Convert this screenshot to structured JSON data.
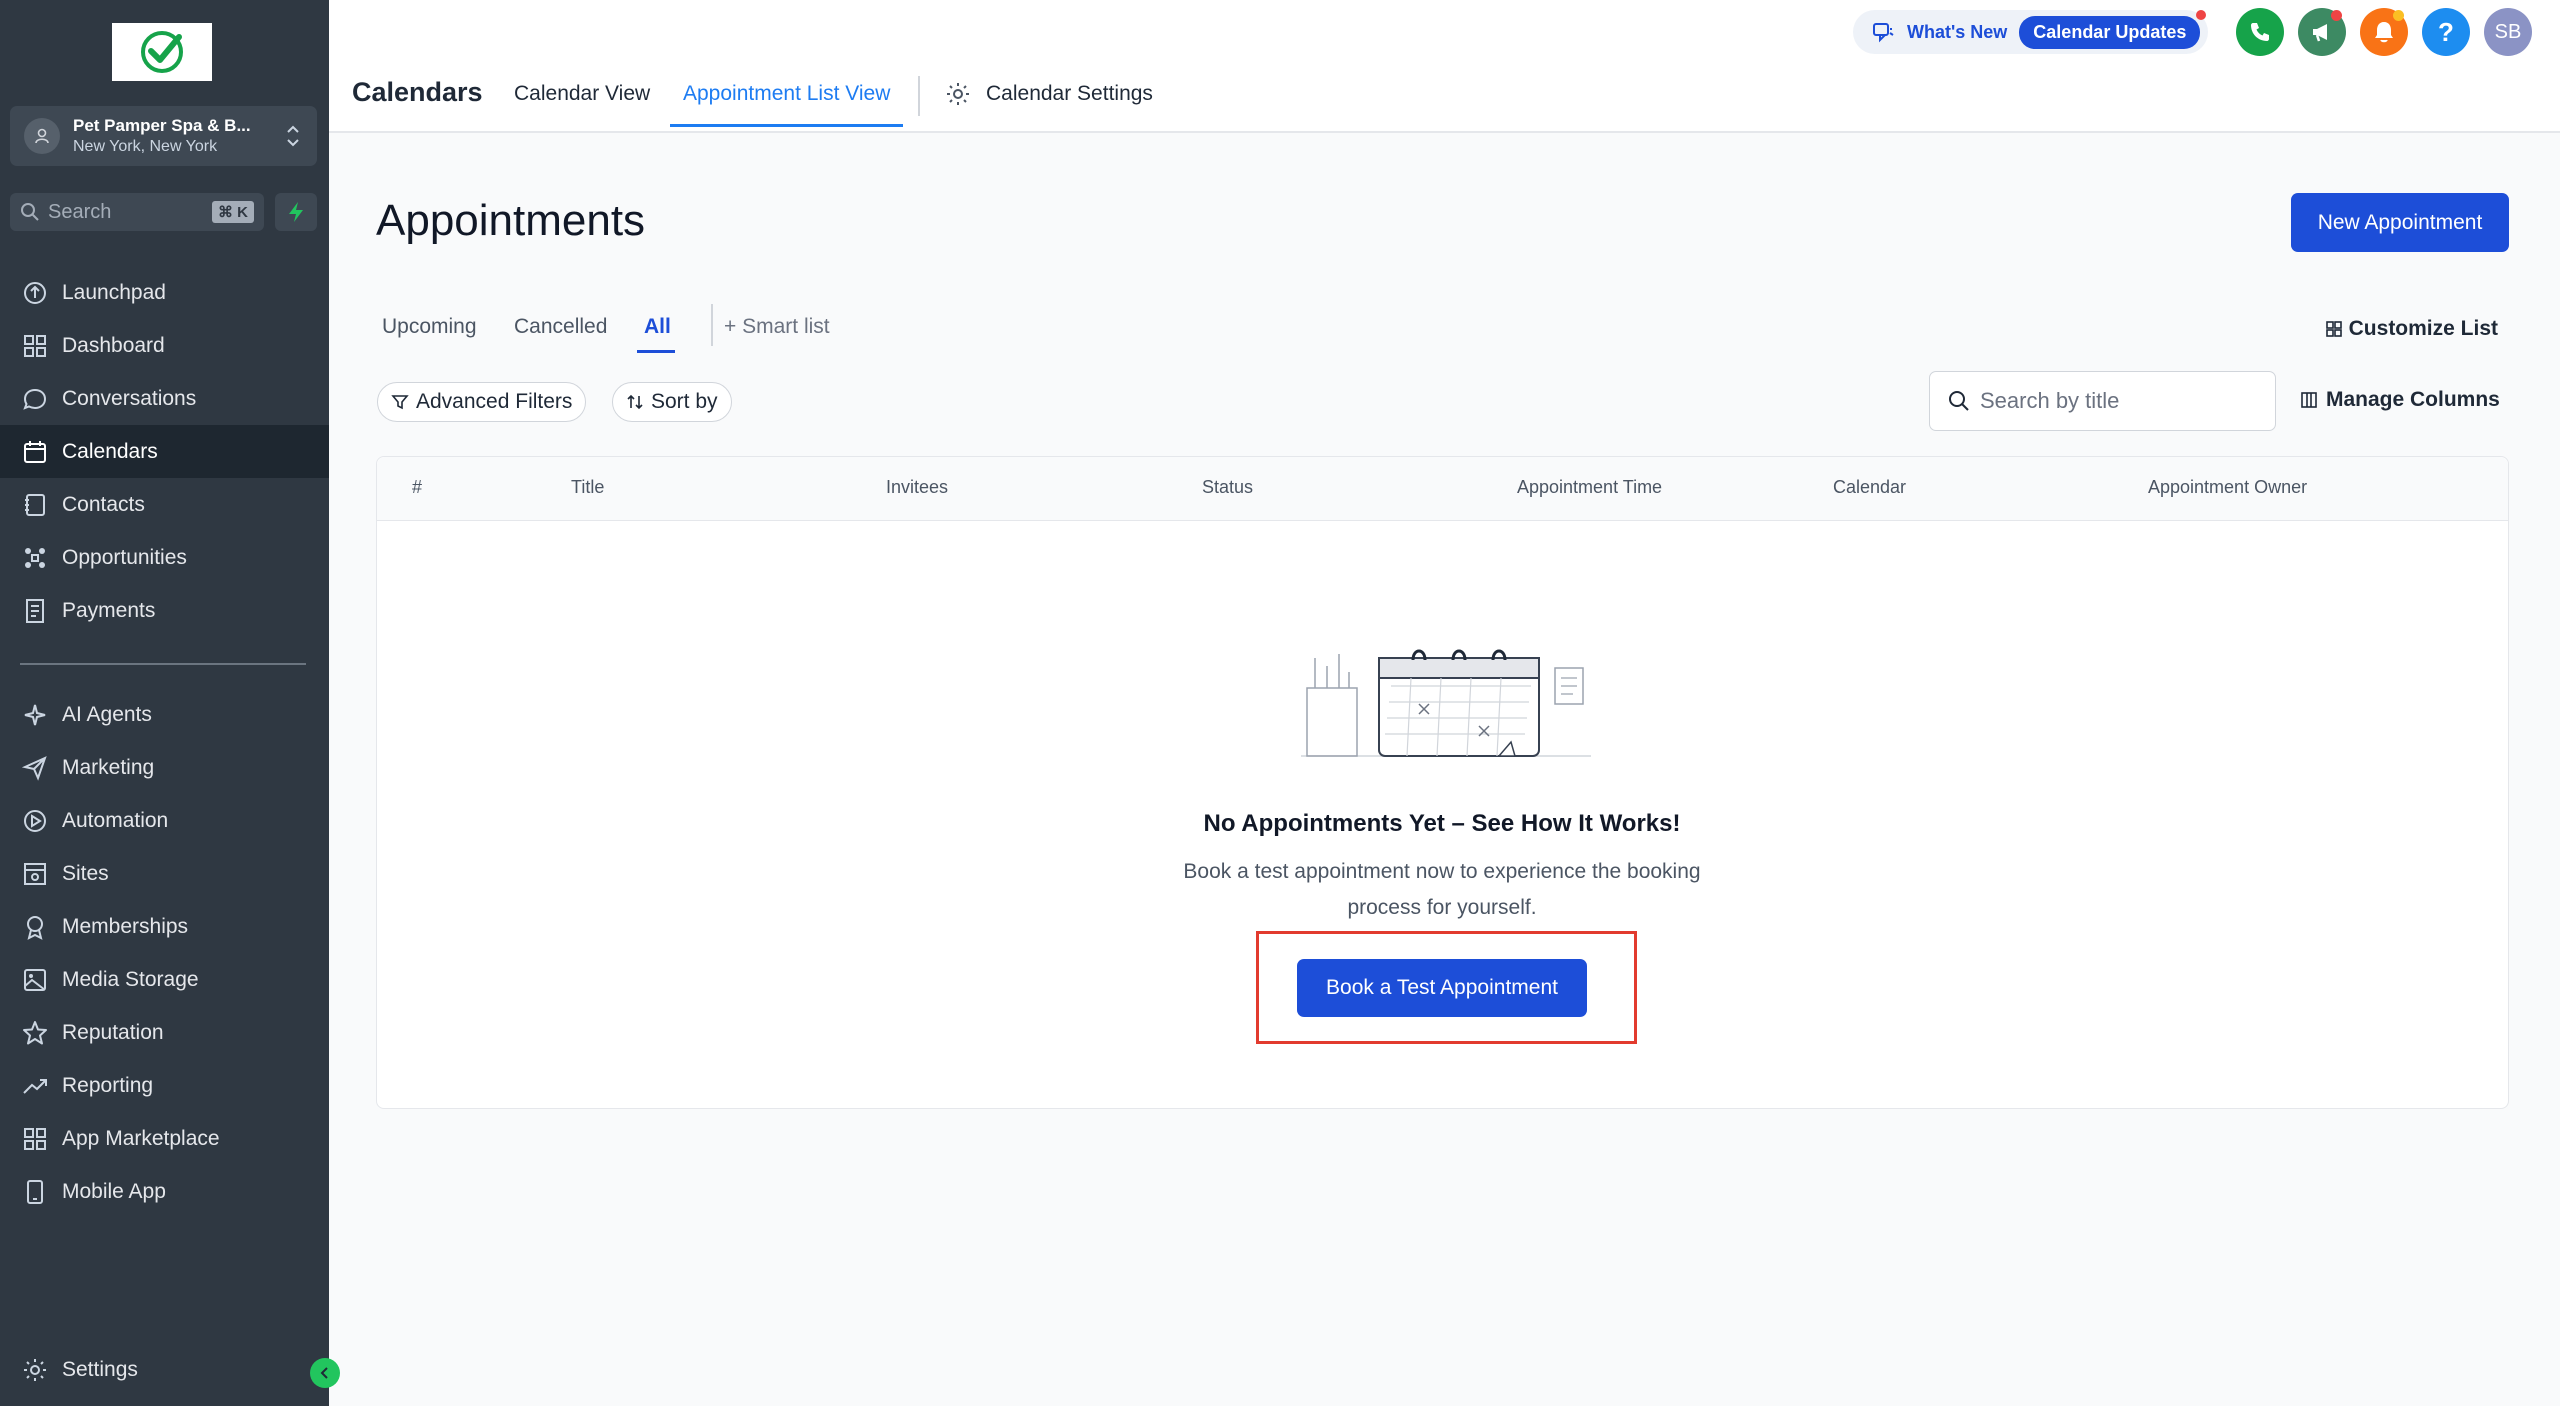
{
  "sidebar": {
    "location": {
      "name": "Pet Pamper Spa & B...",
      "city": "New York, New York"
    },
    "search": {
      "placeholder": "Search",
      "shortcut": "⌘ K"
    },
    "nav_items": [
      {
        "label": "Launchpad",
        "icon": "launchpad-icon"
      },
      {
        "label": "Dashboard",
        "icon": "dashboard-icon"
      },
      {
        "label": "Conversations",
        "icon": "chat-icon"
      },
      {
        "label": "Calendars",
        "icon": "calendar-icon",
        "active": true
      },
      {
        "label": "Contacts",
        "icon": "contacts-icon"
      },
      {
        "label": "Opportunities",
        "icon": "opportunities-icon"
      },
      {
        "label": "Payments",
        "icon": "payments-icon"
      }
    ],
    "nav_items_2": [
      {
        "label": "AI Agents",
        "icon": "sparkle-icon"
      },
      {
        "label": "Marketing",
        "icon": "send-icon"
      },
      {
        "label": "Automation",
        "icon": "automation-icon"
      },
      {
        "label": "Sites",
        "icon": "sites-icon"
      },
      {
        "label": "Memberships",
        "icon": "award-icon"
      },
      {
        "label": "Media Storage",
        "icon": "image-icon"
      },
      {
        "label": "Reputation",
        "icon": "star-icon"
      },
      {
        "label": "Reporting",
        "icon": "trending-icon"
      },
      {
        "label": "App Marketplace",
        "icon": "grid-icon"
      },
      {
        "label": "Mobile App",
        "icon": "phone-icon"
      }
    ],
    "settings_label": "Settings"
  },
  "header": {
    "title": "Calendars",
    "tabs": [
      "Calendar View",
      "Appointment List View"
    ],
    "settings_tab": "Calendar Settings",
    "whats_new": "What's New",
    "calendar_updates": "Calendar Updates",
    "avatar_initials": "SB"
  },
  "main": {
    "heading": "Appointments",
    "new_button": "New Appointment",
    "sub_tabs": [
      "Upcoming",
      "Cancelled",
      "All"
    ],
    "smart_list": "+ Smart list",
    "customize": "Customize List",
    "advanced_filters": "Advanced Filters",
    "sort_by": "Sort by",
    "search_placeholder": "Search by title",
    "manage_columns": "Manage Columns",
    "columns": [
      "#",
      "Title",
      "Invitees",
      "Status",
      "Appointment Time",
      "Calendar",
      "Appointment Owner"
    ],
    "empty": {
      "title": "No Appointments Yet – See How It Works!",
      "description": "Book a test appointment now to experience the booking process for yourself.",
      "button": "Book a Test Appointment"
    }
  },
  "colors": {
    "accent": "#1d4ed8",
    "sidebar": "#2f3842",
    "highlight": "#e23b2e"
  }
}
